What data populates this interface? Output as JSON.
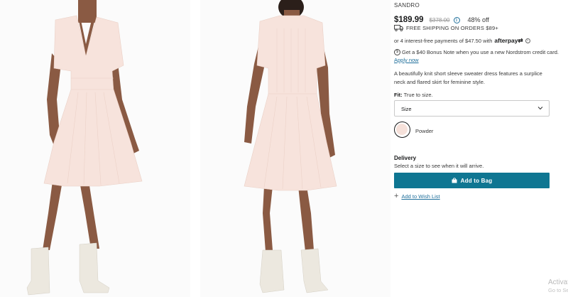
{
  "product": {
    "brand": "SANDRO",
    "price": "$189.99",
    "original_price": "$378.00",
    "discount": "48% off",
    "shipping": "FREE SHIPPING ON ORDERS $89+",
    "afterpay_text": "or 4 interest-free payments of $47.50 with",
    "afterpay_logo": "afterpay",
    "afterpay_logo_suffix": "⇄",
    "bonus_text": "Get a $40 Bonus Note when you use a new Nordstrom credit card.",
    "apply_link": "Apply now",
    "description": "A beautifully knit short sleeve sweater dress features a surplice neck and flared skirt for feminine style.",
    "fit_label": "Fit:",
    "fit_value": "True to size.",
    "size_placeholder": "Size",
    "color_name": "Powder",
    "delivery_title": "Delivery",
    "delivery_text": "Select a size to see when it will arrive.",
    "add_to_bag": "Add to Bag",
    "add_to_wishlist": "Add to Wish List"
  },
  "icons": {
    "info": "i",
    "bonus": "$",
    "plus": "+",
    "truck": "truck-icon",
    "bag": "bag-icon",
    "chevron": "chevron-down-icon"
  },
  "colors": {
    "accent": "#0f7692",
    "link": "#1f6f9b",
    "swatch": "#f6e1da",
    "dress": "#f7e3dc"
  },
  "watermark": {
    "title": "Activate Windows",
    "subtitle": "Go to Settings to activate Windows."
  }
}
